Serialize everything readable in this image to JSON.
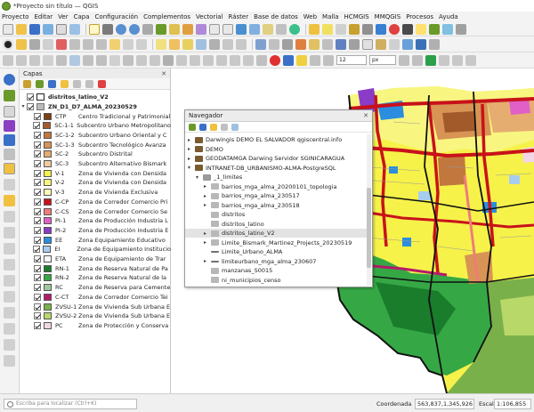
{
  "app": {
    "title": "*Proyecto sin título — QGIS"
  },
  "menu": [
    "Proyecto",
    "Editar",
    "Ver",
    "Capa",
    "Configuración",
    "Complementos",
    "Vectorial",
    "Ráster",
    "Base de datos",
    "Web",
    "Malla",
    "HCMGIS",
    "MMQGIS",
    "Procesos",
    "Ayuda"
  ],
  "toolbar": {
    "font_size": "12",
    "unit": "px"
  },
  "layers_panel": {
    "title": "Capas",
    "root_layer": "distritos_latino_V2",
    "group": "ZN_D1_D7_ALMA_20230529",
    "categories": [
      {
        "code": "CTP",
        "name": "Centro Tradicional y Patrimonial",
        "color": "#7b3f12"
      },
      {
        "code": "SC-1-1",
        "name": "Subcentro Urbano Metropolitano",
        "color": "#a35a2b"
      },
      {
        "code": "SC-1-2",
        "name": "Subcentro Urbano Oriental y C",
        "color": "#c2773e"
      },
      {
        "code": "SC-1-3",
        "name": "Subcentro Tecnológico Avanza",
        "color": "#d89454"
      },
      {
        "code": "SC-2",
        "name": "Subcentro Distrital",
        "color": "#e6ad70"
      },
      {
        "code": "SC-3",
        "name": "Subcentro Alternativo Bismark",
        "color": "#f2c99a"
      },
      {
        "code": "V-1",
        "name": "Zona de Vivienda con Densida",
        "color": "#f6f24a"
      },
      {
        "code": "V-2",
        "name": "Zona de Vivienda con Densida",
        "color": "#f8f680"
      },
      {
        "code": "V-3",
        "name": "Zona de Vivienda Exclusiva",
        "color": "#fbfab5"
      },
      {
        "code": "C-CP",
        "name": "Zona de Corredor Comercio Pri",
        "color": "#c8121a"
      },
      {
        "code": "C-CS",
        "name": "Zona de Corredor Comercio Se",
        "color": "#f07b7b"
      },
      {
        "code": "PI-1",
        "name": "Zona de Producción Industria L",
        "color": "#e060c8"
      },
      {
        "code": "PI-2",
        "name": "Zona de Producción Industria E",
        "color": "#8a3bc8"
      },
      {
        "code": "EE",
        "name": "Zona Equipamiento Educativo",
        "color": "#2a8de0"
      },
      {
        "code": "EI",
        "name": "Zona de Equipamiento Institucio",
        "color": "#a6cdf0"
      },
      {
        "code": "ETA",
        "name": "Zona de Equipamiento de Trar",
        "color": "#f8f8f8"
      },
      {
        "code": "RN-1",
        "name": "Zona de Reserva Natural de Pa",
        "color": "#1a7d2c"
      },
      {
        "code": "RN-2",
        "name": "Zona de Reserva Natural de la",
        "color": "#35a845"
      },
      {
        "code": "RC",
        "name": "Zona de Reserva para Cemente",
        "color": "#9ec99a"
      },
      {
        "code": "C-CT",
        "name": "Zona de Corredor Comercio Tei",
        "color": "#b51a6a"
      },
      {
        "code": "ZVSU-1",
        "name": "Zona de Vivienda Sub Urbana E",
        "color": "#7ab04a"
      },
      {
        "code": "ZVSU-2",
        "name": "Zona de Vivienda Sub Urbana E",
        "color": "#b8d86a"
      },
      {
        "code": "PC",
        "name": "Zona de Protección y Conserva",
        "color": "#f2d7e6"
      }
    ]
  },
  "navigator": {
    "title": "Navegador",
    "items": [
      {
        "depth": 1,
        "arrow": "▸",
        "icon": "postgis",
        "label": "Darwingis DEMO EL SALVADOR qgiscentral.info"
      },
      {
        "depth": 1,
        "arrow": "▸",
        "icon": "postgis",
        "label": "DEMO"
      },
      {
        "depth": 1,
        "arrow": "▸",
        "icon": "postgis",
        "label": "GEODATAMGA Darwing Servidor SGINICARAGUA"
      },
      {
        "depth": 1,
        "arrow": "▾",
        "icon": "postgis",
        "label": "INTRANET-DB_URBANISMO-ALMA-PostgreSQL"
      },
      {
        "depth": 2,
        "arrow": "▾",
        "icon": "schema",
        "label": "_1_limites"
      },
      {
        "depth": 3,
        "arrow": "▸",
        "icon": "polygon",
        "label": "barrios_mga_alma_20200101_topologia"
      },
      {
        "depth": 3,
        "arrow": "▸",
        "icon": "polygon",
        "label": "barrios_mga_alma_230517"
      },
      {
        "depth": 3,
        "arrow": "▸",
        "icon": "polygon",
        "label": "barrios_mga_alma_230518"
      },
      {
        "depth": 3,
        "arrow": "",
        "icon": "polygon",
        "label": "distritos"
      },
      {
        "depth": 3,
        "arrow": "",
        "icon": "polygon",
        "label": "distritos_latino"
      },
      {
        "depth": 3,
        "arrow": "▸",
        "icon": "polygon",
        "label": "distritos_latino_V2",
        "selected": true
      },
      {
        "depth": 3,
        "arrow": "▸",
        "icon": "polygon",
        "label": "Limite_Bismark_Martinez_Projects_20230519"
      },
      {
        "depth": 3,
        "arrow": "",
        "icon": "line",
        "label": "Limite_Urbano_ALMA"
      },
      {
        "depth": 3,
        "arrow": "▸",
        "icon": "line",
        "label": "limiteurbano_mga_alma_230607"
      },
      {
        "depth": 3,
        "arrow": "",
        "icon": "polygon",
        "label": "manzanas_S0015"
      },
      {
        "depth": 3,
        "arrow": "",
        "icon": "polygon",
        "label": "ni_municipios_censo"
      }
    ]
  },
  "status": {
    "search_placeholder": "Escriba para localizar (Ctrl+K)",
    "coord_label": "Coordenada",
    "coord_value": "563,837,1,345,926",
    "scale_label": "Escala",
    "scale_value": "1:106,855"
  }
}
